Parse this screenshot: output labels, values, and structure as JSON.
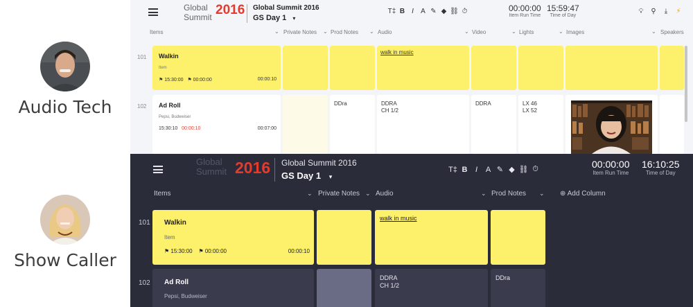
{
  "roles": [
    {
      "name": "Audio Tech"
    },
    {
      "name": "Show Caller"
    }
  ],
  "top": {
    "logo": {
      "line1": "Global",
      "line2": "Summit",
      "year": "2016"
    },
    "event_title": "Global Summit 2016",
    "day": "GS Day 1",
    "toolbar": [
      "T‡",
      "B",
      "I",
      "A",
      "✎",
      "◆",
      "⛓",
      "⏱"
    ],
    "item_run_time": {
      "value": "00:00:00",
      "label": "Item Run Time"
    },
    "time_of_day": {
      "value": "15:59:47",
      "label": "Time of Day"
    },
    "columns": [
      "Items",
      "Private Notes",
      "Prod Notes",
      "Audio",
      "Video",
      "Lights",
      "Images",
      "Speakers"
    ],
    "rows": [
      {
        "num": "101",
        "name": "Walkin",
        "sub": "Item",
        "start": "15:30:00",
        "flag2": "00:00:00",
        "dur": "00:00:10",
        "audio": "walk in music"
      },
      {
        "num": "102",
        "name": "Ad Roll",
        "sub": "Pepsi, Budweiser",
        "start": "15:30:10",
        "late": "00:00:10",
        "dur": "00:07:00",
        "prod_notes": "DDra",
        "audio_l1": "DDRA",
        "audio_l2": "CH 1/2",
        "video": "DDRA",
        "lights_l1": "LX 46",
        "lights_l2": "LX 52"
      }
    ]
  },
  "bottom": {
    "logo": {
      "line1": "Global",
      "line2": "Summit",
      "year": "2016"
    },
    "event_title": "Global Summit 2016",
    "day": "GS Day 1",
    "toolbar": [
      "T‡",
      "B",
      "I",
      "A",
      "✎",
      "◆",
      "⛓",
      "⏱"
    ],
    "item_run_time": {
      "value": "00:00:00",
      "label": "Item Run Time"
    },
    "time_of_day": {
      "value": "16:10:25",
      "label": "Time of Day"
    },
    "columns": [
      "Items",
      "Private Notes",
      "Audio",
      "Prod Notes"
    ],
    "add_column": "Add Column",
    "rows": [
      {
        "num": "101",
        "name": "Walkin",
        "sub": "Item",
        "start": "15:30:00",
        "flag2": "00:00:00",
        "dur": "00:00:10",
        "audio": "walk in music"
      },
      {
        "num": "102",
        "name": "Ad Roll",
        "sub": "Pepsi, Budweiser",
        "audio_l1": "DDRA",
        "audio_l2": "CH 1/2",
        "prod_notes": "DDra"
      }
    ]
  },
  "colors": {
    "yellow": "#fdf06b",
    "dark_bg": "#2a2c3a",
    "logo_red": "#e53b2e"
  }
}
